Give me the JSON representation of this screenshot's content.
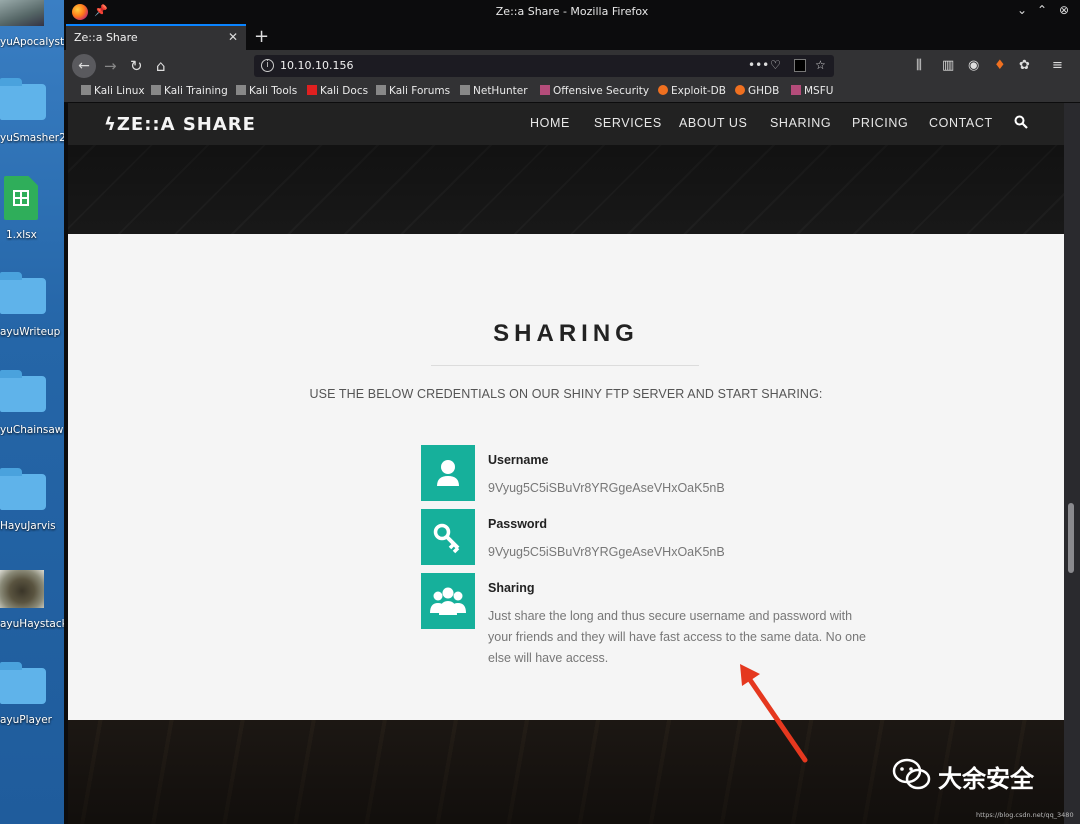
{
  "desktop": {
    "icons": [
      {
        "label": "yuApocalyst"
      },
      {
        "label": "yuSmasher2"
      },
      {
        "label": "1.xlsx"
      },
      {
        "label": "ayuWriteup"
      },
      {
        "label": "yuChainsaw"
      },
      {
        "label": "HayuJarvis"
      },
      {
        "label": "ayuHaystack"
      },
      {
        "label": "ayuPlayer"
      }
    ]
  },
  "window": {
    "title": "Ze::a Share - Mozilla Firefox",
    "tab_title": "Ze::a Share",
    "new_tab": "+",
    "url": "10.10.10.156",
    "url_dots": "•••"
  },
  "bookmarks": [
    {
      "label": "Kali Linux",
      "color": "#888888"
    },
    {
      "label": "Kali Training",
      "color": "#888888"
    },
    {
      "label": "Kali Tools",
      "color": "#888888"
    },
    {
      "label": "Kali Docs",
      "color": "#e02020"
    },
    {
      "label": "Kali Forums",
      "color": "#888888"
    },
    {
      "label": "NetHunter",
      "color": "#888888"
    },
    {
      "label": "Offensive Security",
      "color": "#b44c7a"
    },
    {
      "label": "Exploit-DB",
      "color": "#f07020"
    },
    {
      "label": "GHDB",
      "color": "#f07020"
    },
    {
      "label": "MSFU",
      "color": "#b44c7a"
    }
  ],
  "site": {
    "logo": "ZE::A SHARE",
    "logo_mark": "ϟ",
    "nav": [
      "HOME",
      "SERVICES",
      "ABOUT US",
      "SHARING",
      "PRICING",
      "CONTACT"
    ]
  },
  "section": {
    "title": "SHARING",
    "subtitle": "USE THE BELOW CREDENTIALS ON OUR SHINY FTP SERVER AND START SHARING:",
    "features": [
      {
        "title": "Username",
        "value": "9Vyug5C5iSBuVr8YRGgeAseVHxOaK5nB",
        "icon": "user-icon"
      },
      {
        "title": "Password",
        "value": "9Vyug5C5iSBuVr8YRGgeAseVHxOaK5nB",
        "icon": "key-icon"
      },
      {
        "title": "Sharing",
        "value": "Just share the long and thus secure username and password with your friends and they will have fast access to the same data. No one else will have access.",
        "icon": "group-icon"
      }
    ],
    "accent_color": "#16b09b"
  },
  "watermark": {
    "text": "大余安全",
    "url": "https://blog.csdn.net/qq_3480"
  }
}
